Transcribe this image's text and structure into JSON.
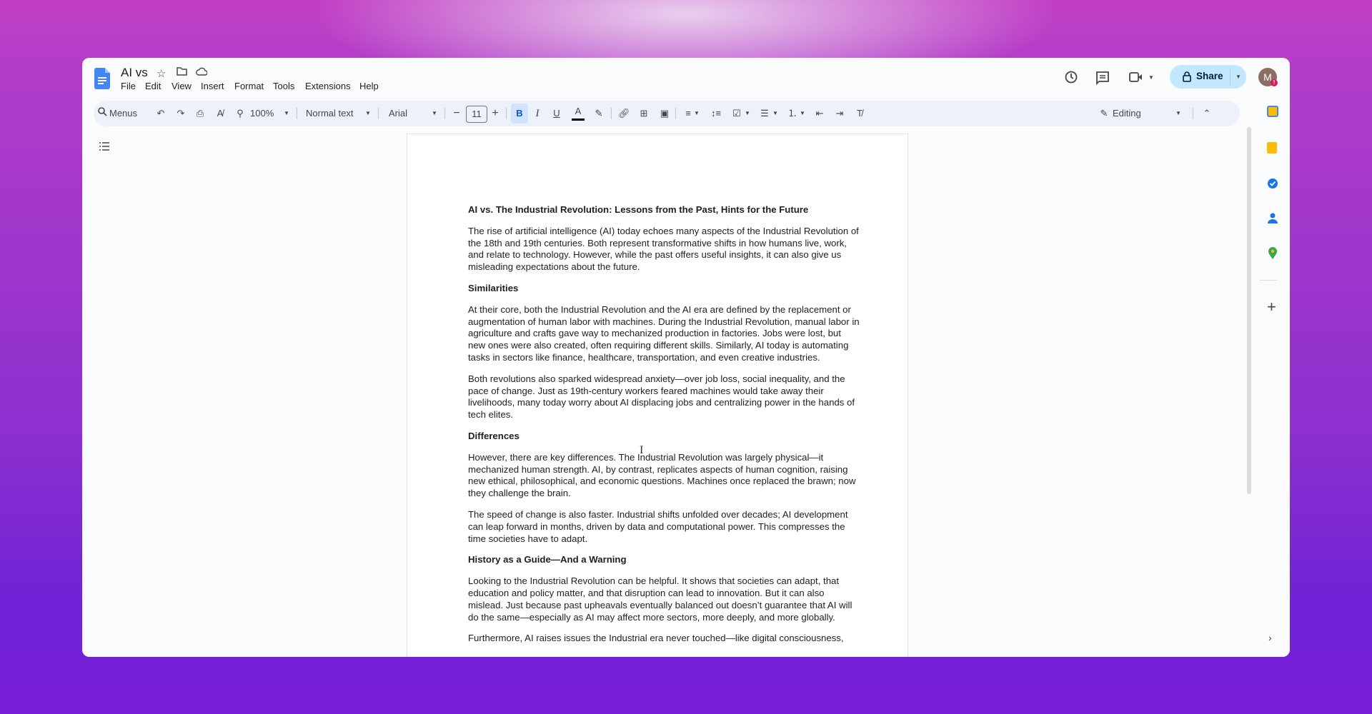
{
  "app": {
    "title": "AI vs",
    "menus": [
      "File",
      "Edit",
      "View",
      "Insert",
      "Format",
      "Tools",
      "Extensions",
      "Help"
    ]
  },
  "header": {
    "share_label": "Share",
    "avatar_initial": "M"
  },
  "toolbar": {
    "search_label": "Menus",
    "zoom": "100%",
    "style": "Normal text",
    "font": "Arial",
    "font_size": "11",
    "mode": "Editing"
  },
  "document": {
    "title": "AI vs. The Industrial Revolution: Lessons from the Past, Hints for the Future",
    "blocks": [
      {
        "type": "p",
        "text": "The rise of artificial intelligence (AI) today echoes many aspects of the Industrial Revolution of the 18th and 19th centuries. Both represent transformative shifts in how humans live, work, and relate to technology. However, while the past offers useful insights, it can also give us misleading expectations about the future."
      },
      {
        "type": "h",
        "text": "Similarities"
      },
      {
        "type": "p",
        "text": "At their core, both the Industrial Revolution and the AI era are defined by the replacement or augmentation of human labor with machines. During the Industrial Revolution, manual labor in agriculture and crafts gave way to mechanized production in factories. Jobs were lost, but new ones were also created, often requiring different skills. Similarly, AI today is automating tasks in sectors like finance, healthcare, transportation, and even creative industries."
      },
      {
        "type": "p",
        "text": "Both revolutions also sparked widespread anxiety—over job loss, social inequality, and the pace of change. Just as 19th-century workers feared machines would take away their livelihoods, many today worry about AI displacing jobs and centralizing power in the hands of tech elites."
      },
      {
        "type": "h",
        "text": "Differences"
      },
      {
        "type": "p",
        "text": "However, there are key differences. The Industrial Revolution was largely physical—it mechanized human strength. AI, by contrast, replicates aspects of human cognition, raising new ethical, philosophical, and economic questions. Machines once replaced the brawn; now they challenge the brain."
      },
      {
        "type": "p",
        "text": "The speed of change is also faster. Industrial shifts unfolded over decades; AI development can leap forward in months, driven by data and computational power. This compresses the time societies have to adapt."
      },
      {
        "type": "h",
        "text": "History as a Guide—And a Warning"
      },
      {
        "type": "p",
        "text": "Looking to the Industrial Revolution can be helpful. It shows that societies can adapt, that education and policy matter, and that disruption can lead to innovation. But it can also mislead. Just because past upheavals eventually balanced out doesn’t guarantee that AI will do the same—especially as AI may affect more sectors, more deeply, and more globally."
      },
      {
        "type": "p",
        "text": "Furthermore, AI raises issues the Industrial era never touched—like digital consciousness,"
      }
    ]
  },
  "colors": {
    "accent": "#0b57d0",
    "share_bg": "#c2e7ff",
    "toolbar_bg": "#edf2fa",
    "doc_blue": "#4285f4"
  }
}
